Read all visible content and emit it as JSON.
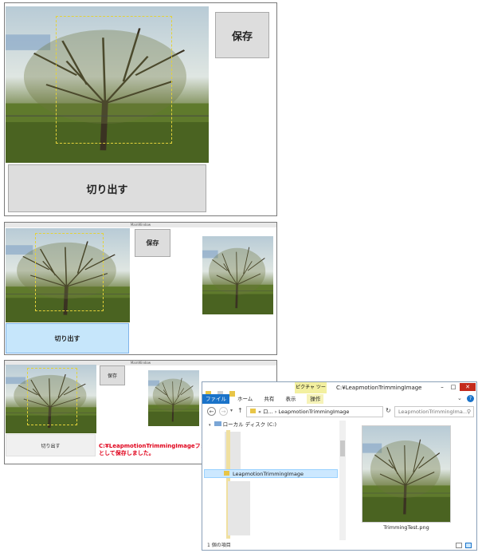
{
  "panel1": {
    "save_label": "保存",
    "crop_label": "切り出す"
  },
  "panel2": {
    "title": "MainWindow",
    "save_label": "保存",
    "crop_label": "切り出す"
  },
  "panel3": {
    "title": "MainWindow",
    "save_label": "保存",
    "crop_label": "切り出す",
    "message_line1": "C:¥LeapmotionTrimmingImageフォルダー",
    "message_line2": "として保存しました。"
  },
  "explorer": {
    "contextual_tab": "ピクチャ ツール",
    "window_title": "C:¥LeapmotionTrimmingImage",
    "tabs": [
      "ファイル",
      "ホーム",
      "共有",
      "表示",
      "操作"
    ],
    "address_path": "« ロ... › LeapmotionTrimmingImage",
    "search_placeholder": "LeapmotionTrimmingIma...",
    "tree_drive": "ローカル ディスク (C:)",
    "tree_selected_folder": "LeapmotionTrimmingImage",
    "file_name": "TrimmingTest.png",
    "status_text": "1 個の項目",
    "colors": {
      "accent": "#1a73c9",
      "contextual": "#f3f0a0",
      "selected": "#cce8ff"
    }
  }
}
